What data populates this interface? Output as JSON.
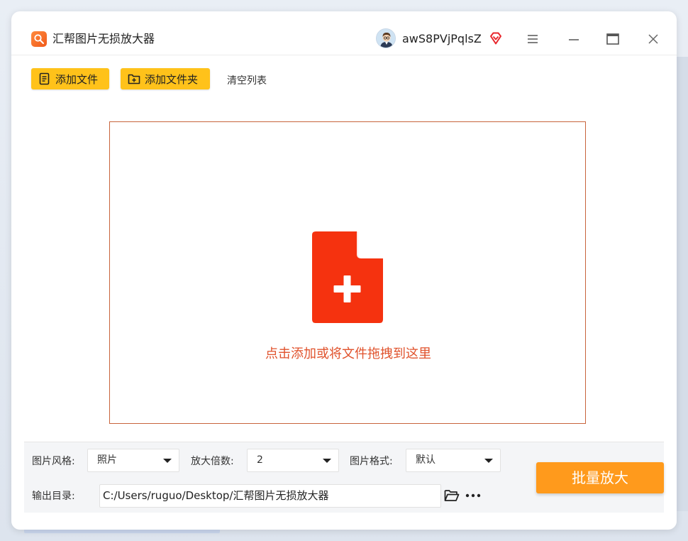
{
  "app": {
    "title": "汇帮图片无损放大器",
    "username": "awS8PVjPqlsZ"
  },
  "toolbar": {
    "add_file_label": "添加文件",
    "add_folder_label": "添加文件夹",
    "clear_list_label": "清空列表"
  },
  "drop_zone": {
    "hint": "点击添加或将文件拖拽到这里"
  },
  "settings": {
    "style_label": "图片风格:",
    "style_value": "照片",
    "scale_label": "放大倍数:",
    "scale_value": "2",
    "format_label": "图片格式:",
    "format_value": "默认",
    "output_label": "输出目录:",
    "output_path": "C:/Users/ruguo/Desktop/汇帮图片无损放大器"
  },
  "actions": {
    "batch_enlarge_label": "批量放大"
  },
  "colors": {
    "accent_yellow": "#ffc21a",
    "accent_orange": "#ff9a1c",
    "drop_border": "#c8643c",
    "file_icon_red": "#f5320f",
    "hint_text": "#e0522c"
  }
}
